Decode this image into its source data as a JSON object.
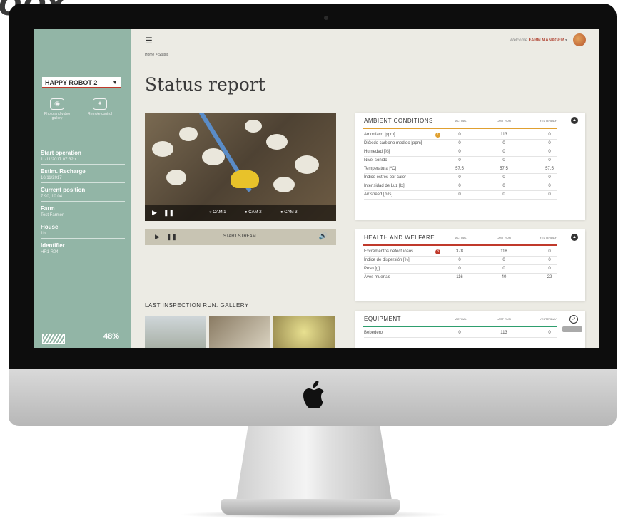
{
  "brand": "OOY",
  "header": {
    "welcome_prefix": "Welcome",
    "user_name": "FARM MANAGER",
    "breadcrumb": "Home > Status",
    "page_title": "Status report"
  },
  "sidebar": {
    "robot_name": "HAPPY ROBOT 2",
    "quick_actions": [
      {
        "label": "Photo and video gallery",
        "icon": "camera-icon"
      },
      {
        "label": "Remote control",
        "icon": "gamepad-icon"
      }
    ],
    "info": [
      {
        "label": "Start operation",
        "value": "11/11/2017 07:32h"
      },
      {
        "label": "Estim. Recharge",
        "value": "10/11/2017"
      },
      {
        "label": "Current position",
        "value": "7.90, 10.04"
      },
      {
        "label": "Farm",
        "value": "Test Farmer"
      },
      {
        "label": "House",
        "value": "1b"
      },
      {
        "label": "Identifier",
        "value": "HR1 R04"
      }
    ],
    "battery_pct": "48%",
    "battery_level": 0.48
  },
  "video": {
    "cams": [
      "CAM 1",
      "CAM 2",
      "CAM 3"
    ]
  },
  "stream": {
    "label": "START STREAM"
  },
  "gallery": {
    "title": "LAST INSPECTION RUN. GALLERY"
  },
  "columns": {
    "actual": "ACTUAL",
    "last_run": "LAST RUN",
    "yesterday": "YESTERDAY"
  },
  "panels": {
    "ambient": {
      "title": "AMBIENT CONDITIONS",
      "accent": "#e0a030",
      "rows": [
        {
          "label": "Amoníaco [ppm]",
          "actual": "0",
          "last": "113",
          "yest": "0",
          "badge": "!"
        },
        {
          "label": "Dióxido carbono medido [ppm]",
          "actual": "0",
          "last": "0",
          "yest": "0"
        },
        {
          "label": "Humedad [%]",
          "actual": "0",
          "last": "0",
          "yest": "0"
        },
        {
          "label": "Nivel sonido",
          "actual": "0",
          "last": "0",
          "yest": "0"
        },
        {
          "label": "Temperatura [ºC]",
          "actual": "57.5",
          "last": "57.5",
          "yest": "57.5"
        },
        {
          "label": "Índice estrés por calor",
          "actual": "0",
          "last": "0",
          "yest": "0"
        },
        {
          "label": "Intensidad de Luz [lx]",
          "actual": "0",
          "last": "0",
          "yest": "0"
        },
        {
          "label": "Air speed [m/s]",
          "actual": "0",
          "last": "0",
          "yest": "0"
        }
      ]
    },
    "health": {
      "title": "HEALTH AND WELFARE",
      "accent": "#c0392b",
      "rows": [
        {
          "label": "Excrementos defectuosos",
          "actual": "378",
          "last": "118",
          "yest": "0",
          "badge": "3"
        },
        {
          "label": "Índice de dispersión [%]",
          "actual": "0",
          "last": "0",
          "yest": "0"
        },
        {
          "label": "Peso [g]",
          "actual": "0",
          "last": "0",
          "yest": "0"
        },
        {
          "label": "Aves muertas",
          "actual": "116",
          "last": "40",
          "yest": "22"
        }
      ]
    },
    "equipment": {
      "title": "EQUIPMENT",
      "accent": "#2e9e6e",
      "rows": [
        {
          "label": "Bebedero",
          "actual": "0",
          "last": "113",
          "yest": "0"
        }
      ]
    }
  }
}
